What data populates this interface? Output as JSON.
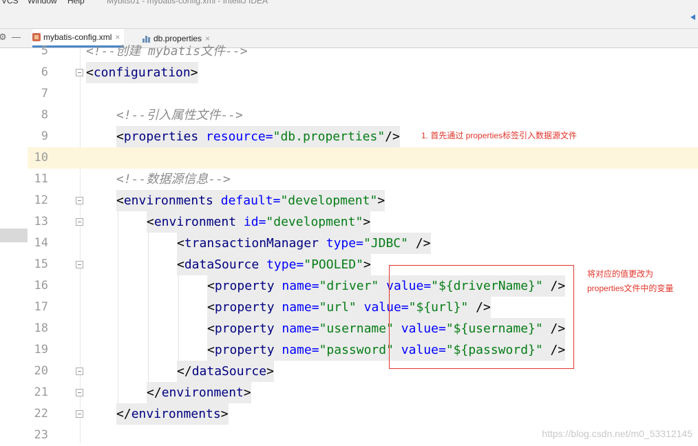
{
  "titlebar": {
    "menu_vcs": "VCS",
    "menu_window": "Window",
    "menu_help": "Help",
    "window_title": "Mybits01 - mybatis-config.xml - IntelliJ IDEA"
  },
  "tabs": [
    {
      "label": "mybatis-config.xml",
      "close": "×",
      "icon": "xml-file-icon",
      "active": true
    },
    {
      "label": "db.properties",
      "close": "×",
      "icon": "properties-file-icon",
      "active": false
    }
  ],
  "editor": {
    "line_numbers": [
      "5",
      "6",
      "7",
      "8",
      "9",
      "10",
      "11",
      "12",
      "13",
      "14",
      "15",
      "16",
      "17",
      "18",
      "19",
      "20",
      "21",
      "22",
      "23"
    ],
    "current_line": "10",
    "lines": {
      "l5": "<!--创建 mybatis文件-->",
      "l6_lt": "<",
      "l6_tag": "configuration",
      "l6_gt": ">",
      "l8": "<!--引入属性文件-->",
      "l9_lt": "<",
      "l9_tag": "properties",
      "l9_attr": " resource",
      "l9_eq": "=",
      "l9_val": "\"db.properties\"",
      "l9_end": "/>",
      "l11": "<!--数据源信息-->",
      "l12_lt": "<",
      "l12_tag": "environments",
      "l12_attr": " default",
      "l12_eq": "=",
      "l12_val": "\"development\"",
      "l12_gt": ">",
      "l13_lt": "<",
      "l13_tag": "environment",
      "l13_attr": " id",
      "l13_eq": "=",
      "l13_val": "\"development\"",
      "l13_gt": ">",
      "l14_lt": "<",
      "l14_tag": "transactionManager",
      "l14_attr": " type",
      "l14_eq": "=",
      "l14_val": "\"JDBC\"",
      "l14_end": " />",
      "l15_lt": "<",
      "l15_tag": "dataSource",
      "l15_attr": " type",
      "l15_eq": "=",
      "l15_val": "\"POOLED\"",
      "l15_gt": ">",
      "l16_lt": "<",
      "l16_tag": "property",
      "l16_a1": " name",
      "l16_eq1": "=",
      "l16_v1": "\"driver\"",
      "l16_a2": " value",
      "l16_eq2": "=",
      "l16_v2": "\"${driverName}\"",
      "l16_end": " />",
      "l17_lt": "<",
      "l17_tag": "property",
      "l17_a1": " name",
      "l17_eq1": "=",
      "l17_v1": "\"url\"",
      "l17_a2": " value",
      "l17_eq2": "=",
      "l17_v2": "\"${url}\"",
      "l17_end": " />",
      "l18_lt": "<",
      "l18_tag": "property",
      "l18_a1": " name",
      "l18_eq1": "=",
      "l18_v1": "\"username\"",
      "l18_a2": " value",
      "l18_eq2": "=",
      "l18_v2": "\"${username}\"",
      "l18_end": " />",
      "l19_lt": "<",
      "l19_tag": "property",
      "l19_a1": " name",
      "l19_eq1": "=",
      "l19_v1": "\"password\"",
      "l19_a2": " value",
      "l19_eq2": "=",
      "l19_v2": "\"${password}\"",
      "l19_end": " />",
      "l20_lt": "</",
      "l20_tag": "dataSource",
      "l20_gt": ">",
      "l21_lt": "</",
      "l21_tag": "environment",
      "l21_gt": ">",
      "l22_lt": "</",
      "l22_tag": "environments",
      "l22_gt": ">"
    }
  },
  "annotations": {
    "note1": "1. 首先通过 properties标签引入数据源文件",
    "note2_line1": "将对应的值更改为",
    "note2_line2": "properties文件中的变量",
    "color": "#e0342a"
  },
  "watermark": "https://blog.csdn.net/m0_53312145",
  "colors": {
    "tag": "#000080",
    "attribute": "#0000ff",
    "value": "#067d17",
    "comment": "#8c8c8c",
    "current_line": "#fdf6dc",
    "tab_underline": "#4a88c7"
  }
}
